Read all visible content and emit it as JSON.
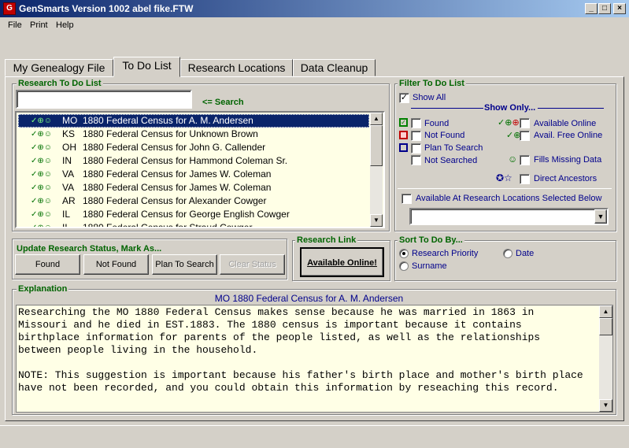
{
  "window": {
    "title": "GenSmarts Version 1002 abel fike.FTW",
    "icon_letter": "G"
  },
  "menu": [
    "File",
    "Print",
    "Help"
  ],
  "tabs": [
    {
      "label": "My Genealogy File",
      "active": false
    },
    {
      "label": "To Do List",
      "active": true
    },
    {
      "label": "Research Locations",
      "active": false
    },
    {
      "label": "Data Cleanup",
      "active": false
    }
  ],
  "research_list": {
    "title": "Research To Do List",
    "search_value": "",
    "search_label": "<= Search",
    "selected_index": 0,
    "items": [
      {
        "state": "MO",
        "text": "1880 Federal Census for A. M. Andersen"
      },
      {
        "state": "KS",
        "text": "1880 Federal Census for Unknown Brown"
      },
      {
        "state": "OH",
        "text": "1880 Federal Census for John G. Callender"
      },
      {
        "state": "IN",
        "text": "1880 Federal Census for Hammond Coleman Sr."
      },
      {
        "state": "VA",
        "text": "1880 Federal Census for James W. Coleman"
      },
      {
        "state": "VA",
        "text": "1880 Federal Census for James W. Coleman"
      },
      {
        "state": "AR",
        "text": "1880 Federal Census for Alexander Cowger"
      },
      {
        "state": "IL",
        "text": "1880 Federal Census for George English Cowger"
      },
      {
        "state": "IL",
        "text": "1880 Federal Census for Straud Cowger"
      }
    ]
  },
  "filter": {
    "title": "Filter To Do List",
    "show_all": {
      "label": "Show All",
      "checked": true
    },
    "show_only_label": "Show Only...",
    "left": [
      {
        "label": "Found",
        "checked": false,
        "icon": "found-icon"
      },
      {
        "label": "Not Found",
        "checked": false,
        "icon": "not-found-icon"
      },
      {
        "label": "Plan To Search",
        "checked": false,
        "icon": "plan-icon"
      },
      {
        "label": "Not Searched",
        "checked": false,
        "icon": ""
      }
    ],
    "right": [
      {
        "label": "Available Online",
        "checked": false,
        "icon": "mouse-icon"
      },
      {
        "label": "Avail. Free Online",
        "checked": false,
        "icon": "free-mouse-icon"
      },
      {
        "label": "Fills Missing Data",
        "checked": false,
        "icon": "smiley-icon"
      },
      {
        "label": "Direct Ancestors",
        "checked": false,
        "icon": "star-icon"
      }
    ],
    "research_locations": {
      "label": "Available At Research Locations Selected Below",
      "checked": false,
      "value": ""
    }
  },
  "update_status": {
    "title": "Update Research Status, Mark As...",
    "buttons": [
      {
        "label": "Found",
        "enabled": true
      },
      {
        "label": "Not Found",
        "enabled": true
      },
      {
        "label": "Plan To Search",
        "enabled": true
      },
      {
        "label": "Clear Status",
        "enabled": false
      }
    ]
  },
  "research_link": {
    "title": "Research Link",
    "button": "Available Online!"
  },
  "sort": {
    "title": "Sort To Do By...",
    "options": [
      {
        "label": "Research Priority",
        "selected": true
      },
      {
        "label": "Date",
        "selected": false
      },
      {
        "label": "Surname",
        "selected": false
      }
    ]
  },
  "explanation": {
    "title": "Explanation",
    "heading": "MO 1880 Federal Census for A. M. Andersen",
    "body": "Researching the MO 1880 Federal Census makes sense because he was married in 1863 in\nMissouri and he died in EST.1883. The 1880 census is important because it contains\nbirthplace information for parents of the people listed, as well as the relationships\nbetween people living in the household.\n\nNOTE: This suggestion is important because his father's birth place and mother's birth place\nhave not been recorded, and you could obtain this information by reseaching this record."
  }
}
